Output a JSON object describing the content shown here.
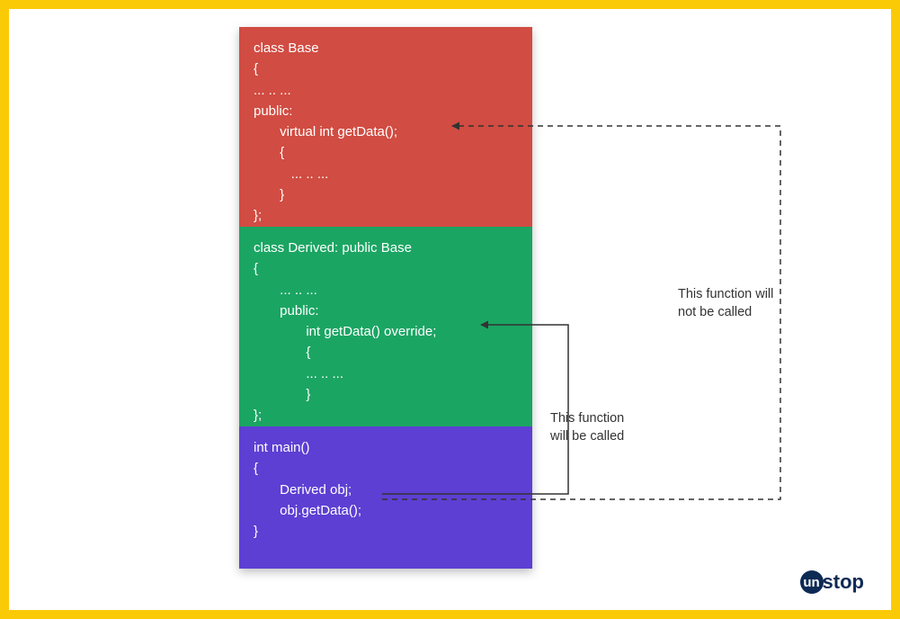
{
  "blocks": {
    "base": "class Base\n{\n... .. ...\npublic:\n       virtual int getData();\n       {\n          ... .. ...\n       }\n};",
    "derived": "class Derived: public Base\n{\n       ... .. ...\n       public:\n              int getData() override;\n              {\n              ... .. ...\n              }\n};",
    "main": "int main()\n{\n       Derived obj;\n       obj.getData();\n}"
  },
  "annotations": {
    "not_called": "This function will\nnot be called",
    "called": "This function\nwill be called"
  },
  "colors": {
    "frame": "#fbca07",
    "base_block": "#d14c42",
    "derived_block": "#1ba563",
    "main_block": "#5d3fd3"
  },
  "logo": {
    "bubble": "un",
    "rest": "stop"
  }
}
